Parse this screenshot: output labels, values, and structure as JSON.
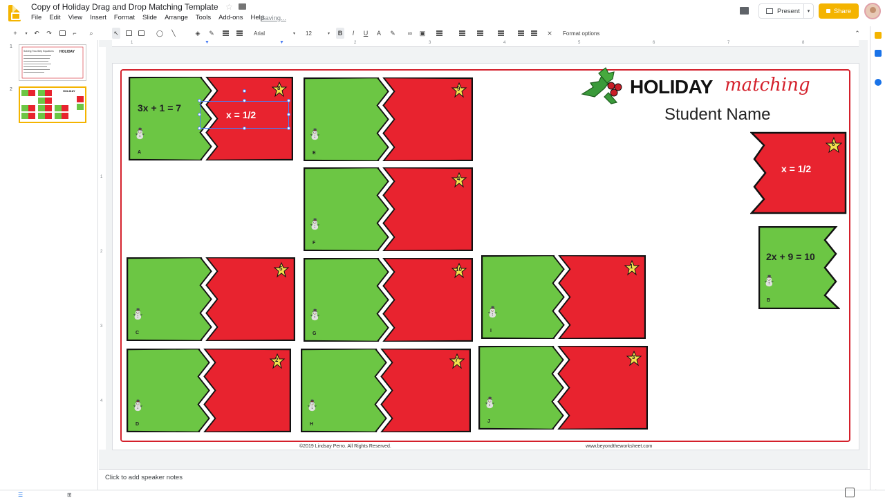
{
  "window": {
    "title": "Copy of Holiday Drag and Drop Matching Template",
    "saving_status": "Saving..."
  },
  "menu": [
    "File",
    "Edit",
    "View",
    "Insert",
    "Format",
    "Slide",
    "Arrange",
    "Tools",
    "Add-ons",
    "Help"
  ],
  "header_buttons": {
    "present": "Present",
    "share": "Share"
  },
  "toolbar": {
    "font": "Arial",
    "font_size": "12",
    "format_options": "Format options",
    "icons": [
      "new-slide-icon",
      "undo-icon",
      "redo-icon",
      "print-icon",
      "paint-format-icon",
      "zoom-icon",
      "select-icon",
      "textbox-icon",
      "image-icon",
      "shape-icon",
      "line-icon",
      "fill-color-icon",
      "border-color-icon",
      "border-weight-icon",
      "border-dash-icon",
      "bold-icon",
      "italic-icon",
      "underline-icon",
      "text-color-icon",
      "highlight-icon",
      "link-icon",
      "comment-add-icon",
      "align-icon",
      "line-spacing-icon",
      "numbered-list-icon",
      "bulleted-list-icon",
      "indent-less-icon",
      "indent-more-icon",
      "clear-format-icon",
      "collapse-icon"
    ]
  },
  "ruler": {
    "h": [
      "1",
      "2",
      "3",
      "4",
      "5",
      "6",
      "7",
      "8"
    ],
    "v": [
      "1",
      "2",
      "3",
      "4"
    ]
  },
  "slides_panel": [
    {
      "num": "1"
    },
    {
      "num": "2",
      "selected": true
    }
  ],
  "slide": {
    "header": {
      "title": "HOLIDAY",
      "script": "matching",
      "student": "Student Name"
    },
    "footer_left": "©2019 Lindsay Perro. All Rights Reserved.",
    "footer_right": "www.beyondtheworksheet.com",
    "selected_text": "x = 1/2",
    "cards": [
      {
        "green": "3x + 1 = 7",
        "letter": "A",
        "num": "8",
        "red": ""
      },
      {
        "green": "",
        "letter": "E",
        "num": "9",
        "red": ""
      },
      {
        "green": "",
        "letter": "F",
        "num": "4",
        "red": ""
      },
      {
        "green": "",
        "letter": "C",
        "num": "5",
        "red": ""
      },
      {
        "green": "",
        "letter": "G",
        "num": "10",
        "red": ""
      },
      {
        "green": "",
        "letter": "I",
        "num": "1",
        "red": ""
      },
      {
        "green": "",
        "letter": "D",
        "num": "2",
        "red": ""
      },
      {
        "green": "",
        "letter": "H",
        "num": "7",
        "red": ""
      },
      {
        "green": "",
        "letter": "J",
        "num": "3",
        "red": ""
      }
    ],
    "loose_red": {
      "text": "x = 1/2",
      "num": "6"
    },
    "loose_green": {
      "text": "2x + 9 = 10",
      "letter": "B"
    }
  },
  "notes": {
    "placeholder": "Click to add speaker notes"
  },
  "colors": {
    "green": "#6cc644",
    "red": "#e8232f",
    "accent": "#f4b400",
    "frame": "#d4202b"
  }
}
